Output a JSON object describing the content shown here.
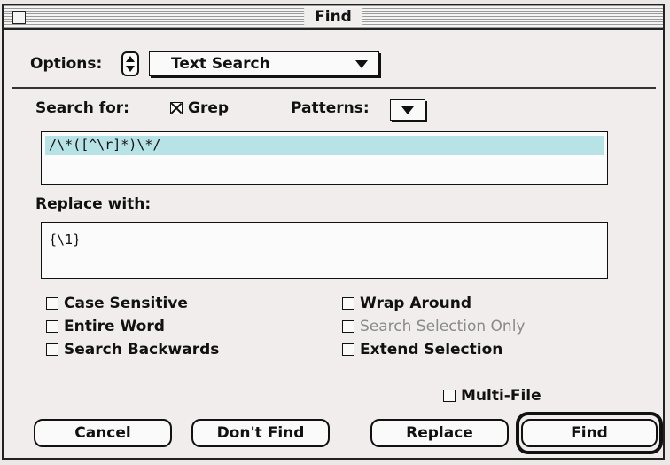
{
  "window": {
    "title": "Find"
  },
  "options": {
    "label": "Options:",
    "selected": "Text Search"
  },
  "search": {
    "label": "Search for:",
    "grep_label": "Grep",
    "grep_checked": true,
    "patterns_label": "Patterns:",
    "value": "/\\*([^\\r]*)\\*/"
  },
  "replace": {
    "label": "Replace with:",
    "value": "{\\1}"
  },
  "checkboxes": {
    "case_sensitive": "Case Sensitive",
    "entire_word": "Entire Word",
    "search_backwards": "Search Backwards",
    "wrap_around": "Wrap Around",
    "search_selection_only": "Search Selection Only",
    "extend_selection": "Extend Selection",
    "multi_file": "Multi-File"
  },
  "buttons": {
    "cancel": "Cancel",
    "dont_find": "Don't Find",
    "replace": "Replace",
    "find": "Find"
  },
  "colors": {
    "selection_highlight": "#b7e2e6",
    "disabled_text": "#8a8a8a"
  }
}
